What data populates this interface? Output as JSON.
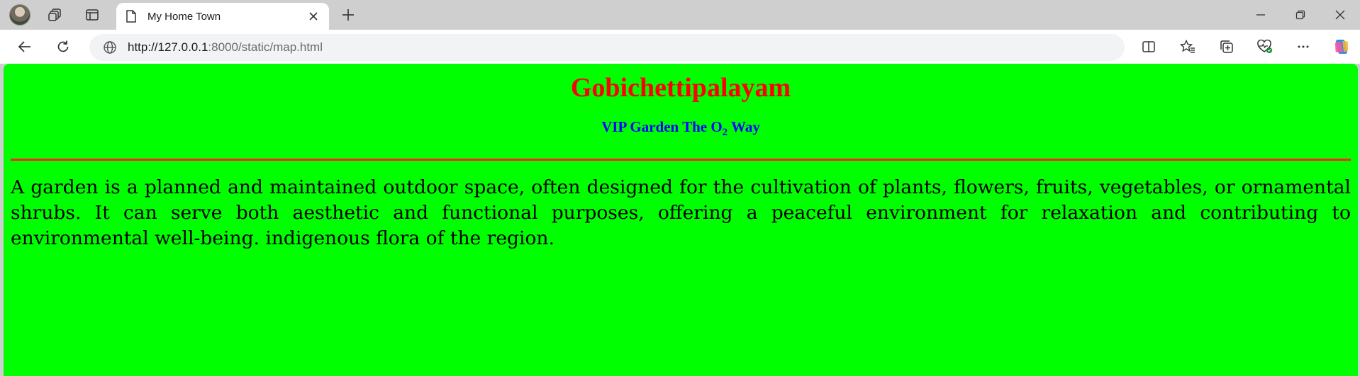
{
  "browser": {
    "tab": {
      "title": "My Home Town"
    },
    "address_bar": {
      "url_host": "http://127.0.0.1",
      "url_rest": ":8000/static/map.html"
    },
    "icons": {
      "profile": "avatar",
      "workspaces": "workspaces-icon",
      "tab_actions": "tab-actions-icon",
      "favicon": "page-icon",
      "close_tab": "close-icon",
      "new_tab": "plus-icon",
      "minimize": "minimize-icon",
      "restore": "restore-icon",
      "close_window": "close-icon",
      "back": "back-arrow-icon",
      "refresh": "refresh-icon",
      "site_info": "globe-icon",
      "split_screen": "split-screen-icon",
      "favorites": "favorites-icon",
      "collections": "collections-icon",
      "browser_essentials": "heart-pulse-icon",
      "more": "more-icon",
      "copilot": "copilot-icon"
    }
  },
  "page": {
    "heading": "Gobichettipalayam",
    "subheading_text": "VIP Garden The O",
    "subheading_sub": "2",
    "subheading_tail": " Way",
    "paragraph": "A garden is a planned and maintained outdoor space, often designed for the cultivation of plants, flowers, fruits, vegetables, or ornamental shrubs. It can serve both aesthetic and functional purposes, offering a peaceful environment for relaxation and contributing to environmental well-being. indigenous flora of the region.",
    "colors": {
      "background": "#00ff00",
      "heading": "#ff0000",
      "subheading": "#0000ff",
      "rule": "#ff2020",
      "text": "#000000"
    }
  }
}
